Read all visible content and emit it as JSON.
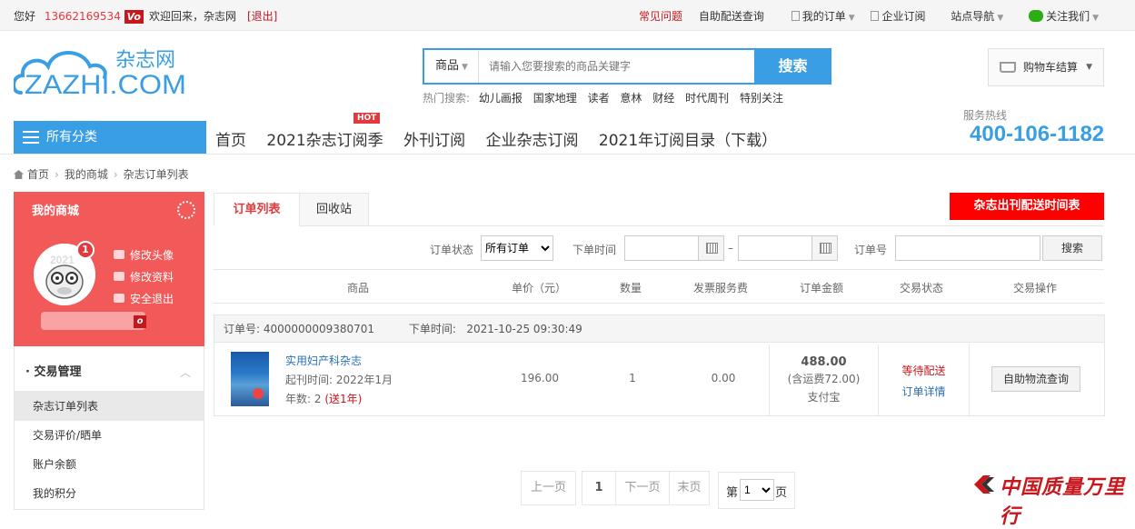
{
  "topbar": {
    "greeting": "您好",
    "phone": "13662169534",
    "vip_badge": "Vo",
    "welcome": "欢迎回来，",
    "site": "杂志网",
    "logout_open": "[",
    "logout": "退出",
    "logout_close": "]",
    "links": [
      "常见问题",
      "自助配送查询",
      "我的订单",
      "企业订阅",
      "站点导航",
      "关注我们"
    ]
  },
  "logo": {
    "cn": "杂志网",
    "en": "ZAZHI.COM"
  },
  "search": {
    "category": "商品",
    "placeholder": "请输入您要搜索的商品关键字",
    "button": "搜索",
    "hot_label": "热门搜索:",
    "hot_items": [
      "幼儿画报",
      "国家地理",
      "读者",
      "意林",
      "财经",
      "时代周刊",
      "特别关注"
    ]
  },
  "cart": {
    "label": "购物车结算"
  },
  "nav": {
    "all_categories": "所有分类",
    "items": [
      "首页",
      "2021杂志订阅季",
      "外刊订阅",
      "企业杂志订阅",
      "2021年订阅目录（下载）"
    ],
    "hot_tag": "HOT",
    "hotline_label": "服务热线",
    "hotline": "400-106-1182"
  },
  "breadcrumb": [
    "首页",
    "我的商城",
    "杂志订单列表"
  ],
  "sidebar": {
    "title": "我的商城",
    "badge": "1",
    "avatar_year": "2021",
    "links": [
      "修改头像",
      "修改资料",
      "安全退出"
    ],
    "user_tag": "o",
    "group": "· 交易管理",
    "items": [
      "杂志订单列表",
      "交易评价/晒单",
      "账户余额",
      "我的积分"
    ]
  },
  "tabs": [
    "订单列表",
    "回收站"
  ],
  "schedule_button": "杂志出刊配送时间表",
  "filter": {
    "status_label": "订单状态",
    "status_value": "所有订单",
    "date_label": "下单时间",
    "date_sep": "–",
    "order_no_label": "订单号",
    "search_button": "搜索"
  },
  "table_headers": [
    "商品",
    "单价（元）",
    "数量",
    "发票服务费",
    "订单金额",
    "交易状态",
    "交易操作"
  ],
  "order": {
    "order_no_label": "订单号:",
    "order_no": "4000000009380701",
    "time_label": "下单时间:",
    "time": "2021-10-25 09:30:49",
    "product": "实用妇产科杂志",
    "start_label": "起刊时间:",
    "start": "2022年1月",
    "years_label": "年数:",
    "years": "2",
    "gift": "(送1年)",
    "price": "196.00",
    "quantity": "1",
    "invoice_fee": "0.00",
    "amount": "488.00",
    "shipping": "(含运费72.00)",
    "payment": "支付宝",
    "status": "等待配送",
    "detail_link": "订单详情",
    "action": "自助物流查询"
  },
  "pager": {
    "prev": "上一页",
    "current": "1",
    "next": "下一页",
    "last": "末页",
    "page_prefix": "第",
    "page_value": "1",
    "page_suffix": "页"
  },
  "watermark": "中国质量万里行",
  "colors": {
    "brand_blue": "#3a9ee4",
    "brand_red": "#f25a5a",
    "alert_red": "#ff0000"
  }
}
